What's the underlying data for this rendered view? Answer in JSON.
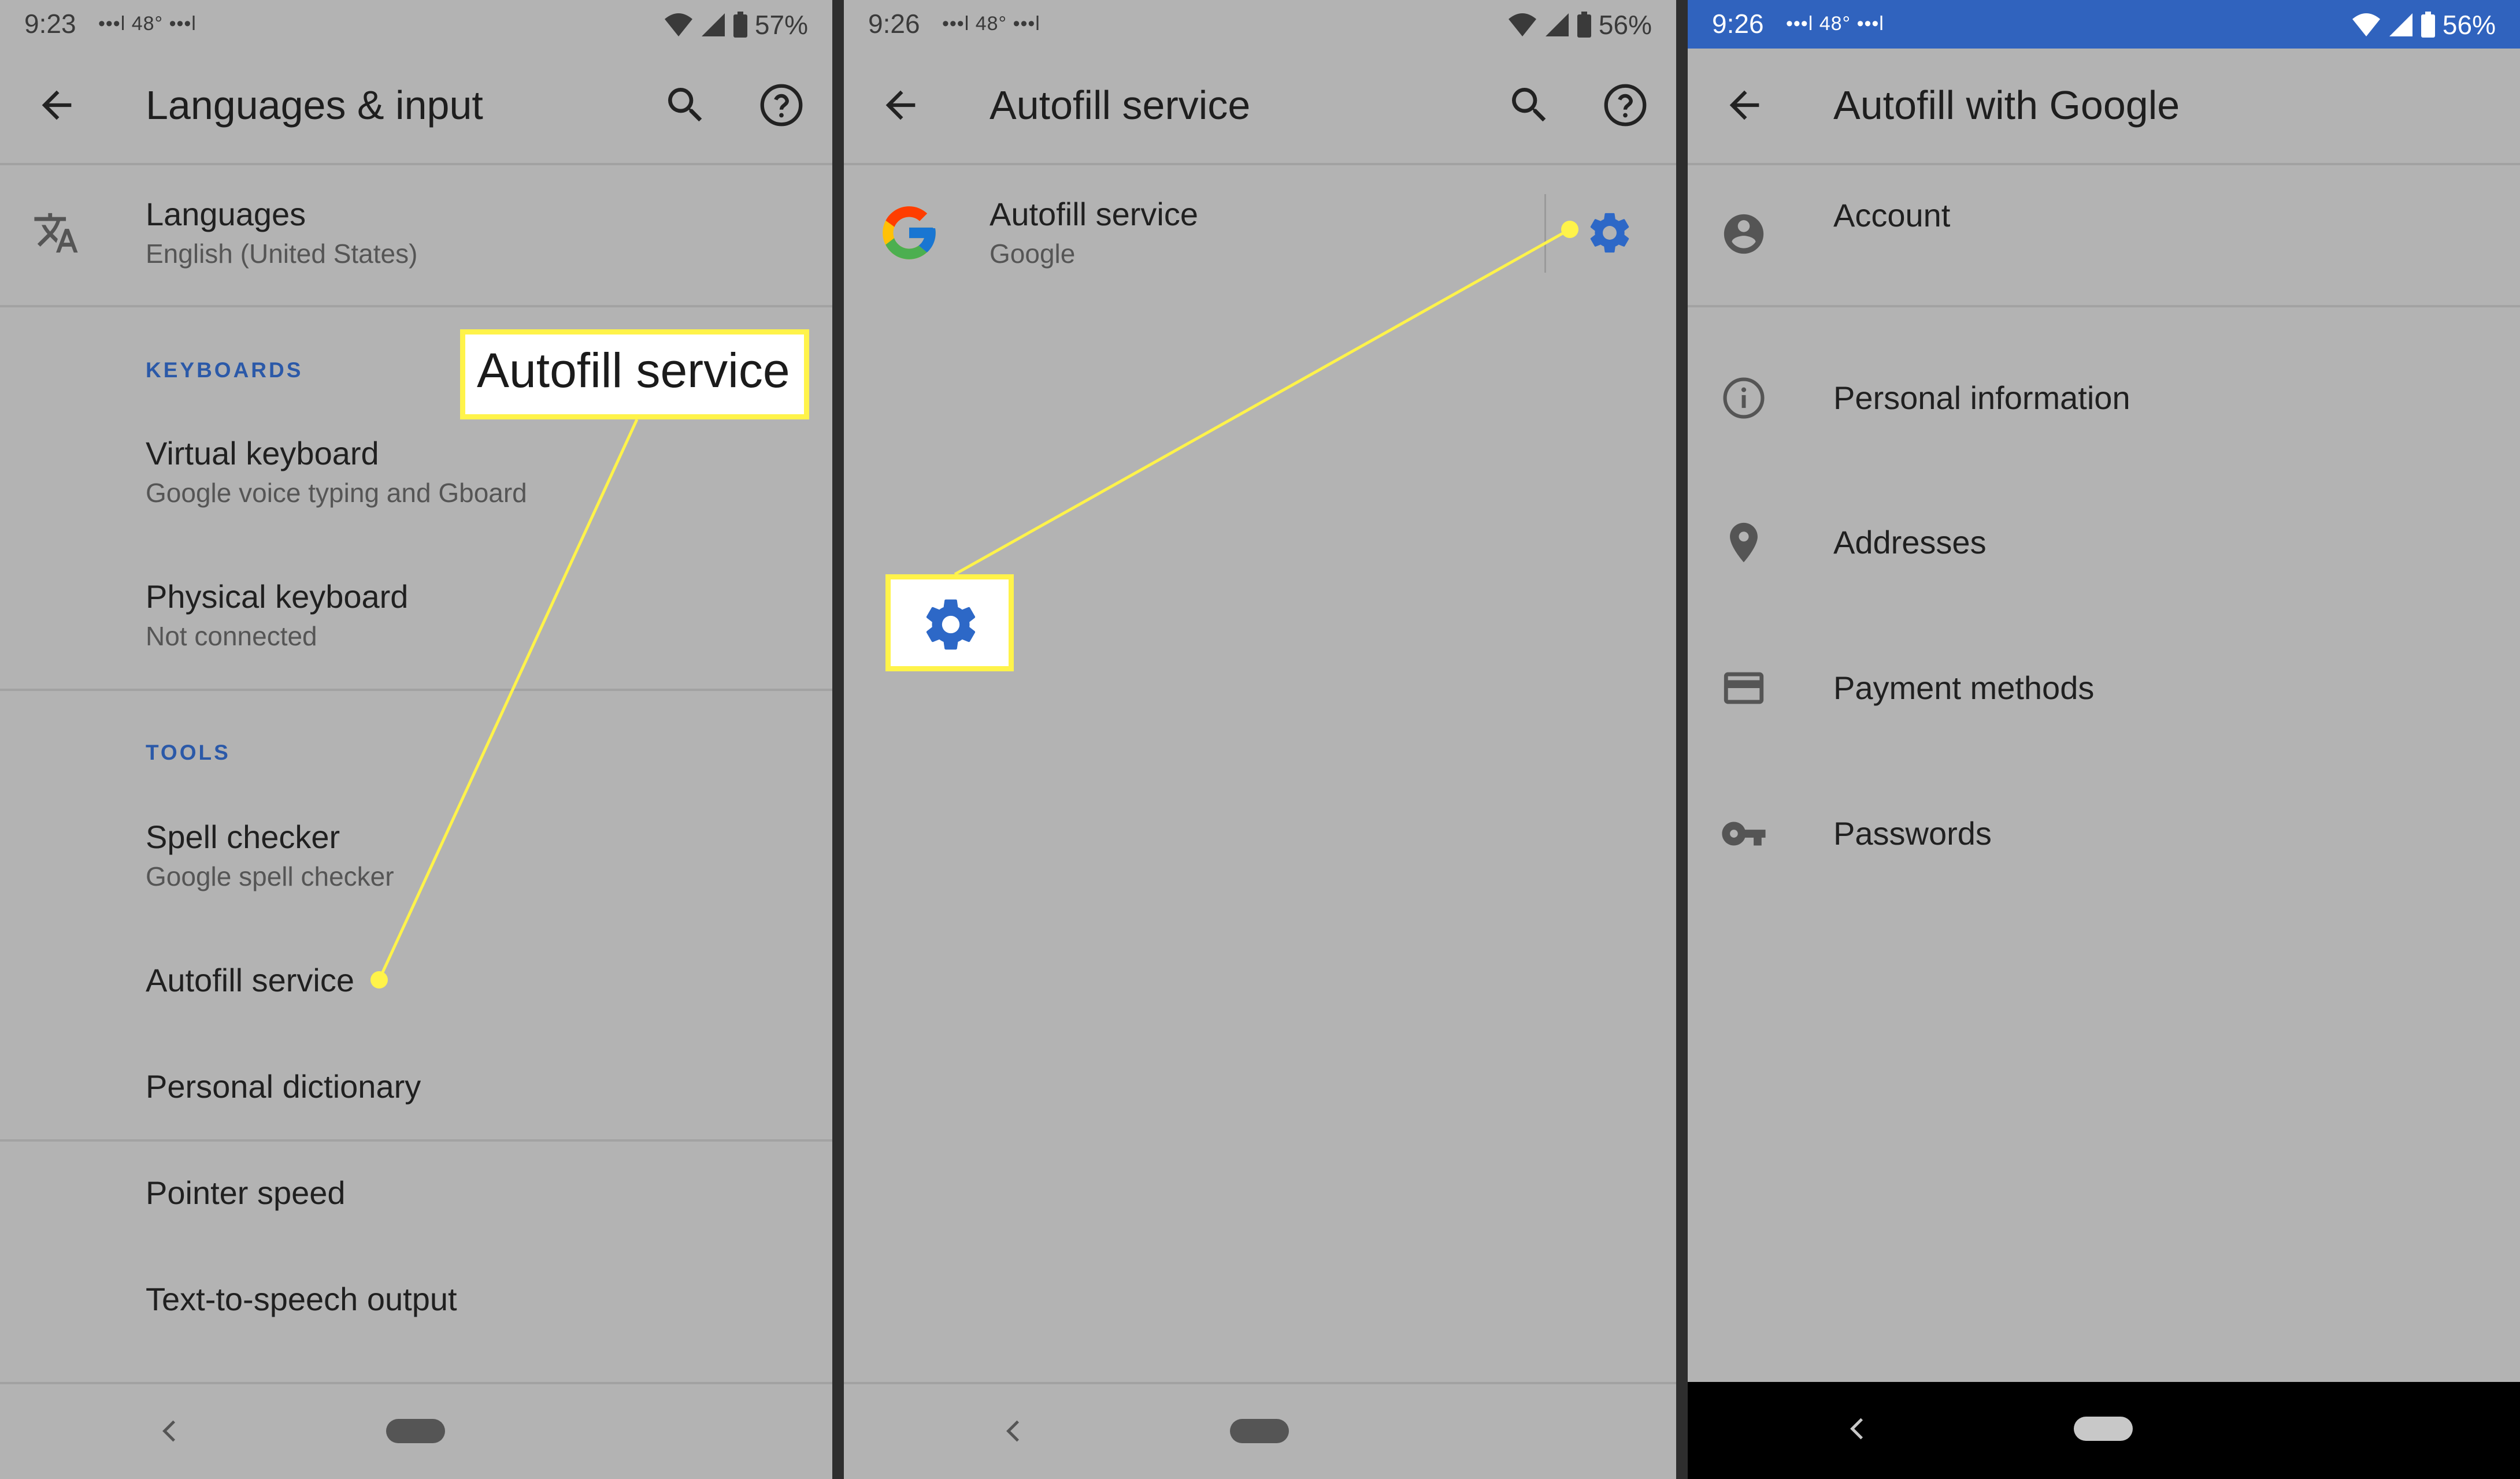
{
  "colors": {
    "panel_bg": "#b3b3b3",
    "accent_blue": "#2b59a8",
    "callout_yellow": "#fff34a",
    "status_bar_blue": "#3063be"
  },
  "panel1": {
    "status": {
      "time": "9:23",
      "extra": "•••l 48° •••l",
      "battery": "57%"
    },
    "title": "Languages & input",
    "languages": {
      "title": "Languages",
      "subtitle": "English (United States)"
    },
    "keyboards_header": "KEYBOARDS",
    "virtual_keyboard": {
      "title": "Virtual keyboard",
      "subtitle": "Google voice typing and Gboard"
    },
    "physical_keyboard": {
      "title": "Physical keyboard",
      "subtitle": "Not connected"
    },
    "tools_header": "TOOLS",
    "spell_checker": {
      "title": "Spell checker",
      "subtitle": "Google spell checker"
    },
    "autofill_service": "Autofill service",
    "personal_dictionary": "Personal dictionary",
    "pointer_speed": "Pointer speed",
    "tts_output": "Text-to-speech output",
    "callout_label": "Autofill service"
  },
  "panel2": {
    "status": {
      "time": "9:26",
      "extra": "•••l 48° •••l",
      "battery": "56%"
    },
    "title": "Autofill service",
    "service": {
      "title": "Autofill service",
      "subtitle": "Google"
    }
  },
  "panel3": {
    "status": {
      "time": "9:26",
      "extra": "•••l 48° •••l",
      "battery": "56%"
    },
    "title": "Autofill with Google",
    "items": [
      {
        "label": "Account",
        "icon": "account-circle-icon"
      },
      {
        "label": "Personal information",
        "icon": "info-icon"
      },
      {
        "label": "Addresses",
        "icon": "location-pin-icon"
      },
      {
        "label": "Payment methods",
        "icon": "credit-card-icon"
      },
      {
        "label": "Passwords",
        "icon": "key-icon"
      }
    ]
  }
}
